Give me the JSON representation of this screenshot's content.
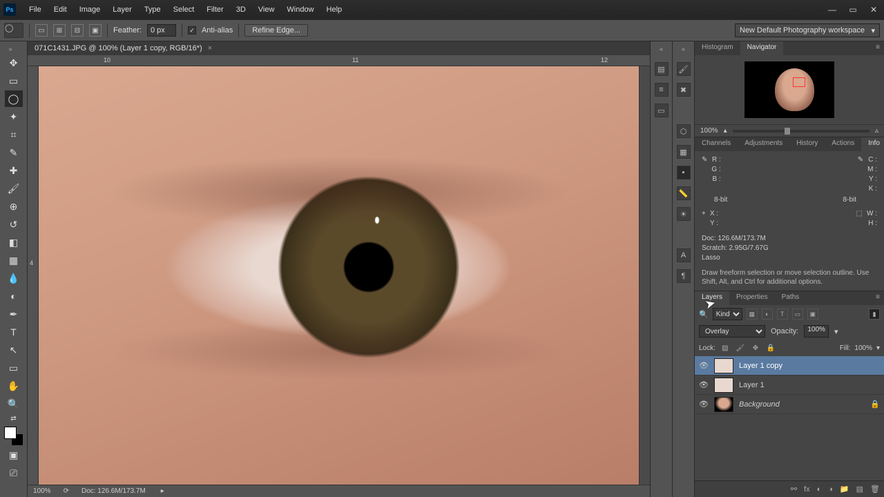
{
  "title_icon": "Ps",
  "menubar": [
    "File",
    "Edit",
    "Image",
    "Layer",
    "Type",
    "Select",
    "Filter",
    "3D",
    "View",
    "Window",
    "Help"
  ],
  "optbar": {
    "feather_label": "Feather:",
    "feather_value": "0 px",
    "antialias_label": "Anti-alias",
    "antialias_checked": true,
    "refine_label": "Refine Edge...",
    "workspace": "New Default Photography workspace"
  },
  "doc": {
    "tab": "071C1431.JPG @ 100% (Layer 1 copy, RGB/16*)",
    "ruler_h": [
      {
        "pos": 110,
        "label": "10"
      },
      {
        "pos": 470,
        "label": "11"
      },
      {
        "pos": 830,
        "label": "12"
      }
    ],
    "ruler_v": [
      {
        "pos": 280,
        "label": "4"
      }
    ],
    "status_zoom": "100%",
    "status_doc": "Doc: 126.6M/173.7M"
  },
  "nav_tabs": [
    "Histogram",
    "Navigator"
  ],
  "nav_active": 1,
  "nav_zoom": "100%",
  "info_tabs": [
    "Channels",
    "Adjustments",
    "History",
    "Actions",
    "Info"
  ],
  "info_active": 4,
  "info": {
    "rgb_labels": [
      "R :",
      "G :",
      "B :"
    ],
    "cmyk_labels": [
      "C :",
      "M :",
      "Y :",
      "K :"
    ],
    "bit1": "8-bit",
    "bit2": "8-bit",
    "xy_labels": [
      "X :",
      "Y :"
    ],
    "wh_labels": [
      "W :",
      "H :"
    ],
    "doc_line": "Doc: 126.6M/173.7M",
    "scratch_line": "Scratch: 2.95G/7.67G",
    "tool_line": "Lasso",
    "hint": "Draw freeform selection or move selection outline. Use Shift, Alt, and Ctrl for additional options."
  },
  "layers_tabs": [
    "Layers",
    "Properties",
    "Paths"
  ],
  "layers_active": 0,
  "layers": {
    "filter_kind": "Kind",
    "blend_mode": "Overlay",
    "opacity_label": "Opacity:",
    "opacity_value": "100%",
    "lock_label": "Lock:",
    "fill_label": "Fill:",
    "fill_value": "100%",
    "items": [
      {
        "name": "Layer 1 copy",
        "selected": true,
        "locked": false,
        "bg": false
      },
      {
        "name": "Layer 1",
        "selected": false,
        "locked": false,
        "bg": false
      },
      {
        "name": "Background",
        "selected": false,
        "locked": true,
        "bg": true,
        "italic": true
      }
    ]
  }
}
